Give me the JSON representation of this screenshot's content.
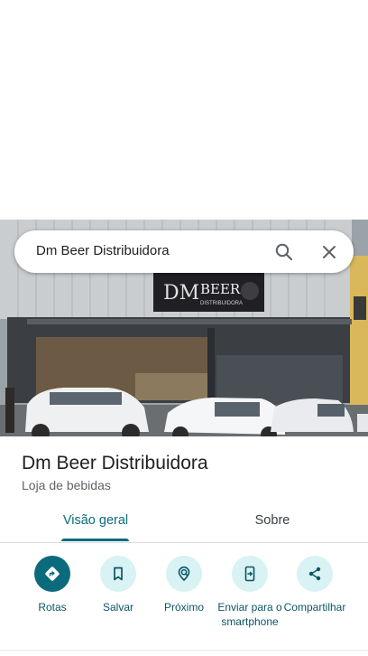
{
  "search": {
    "query": "Dm Beer Distribuidora"
  },
  "photo": {
    "sign_brand": "BEER",
    "sign_sub": "DISTRIBUIDORA"
  },
  "place": {
    "title": "Dm Beer Distribuidora",
    "category": "Loja de bebidas"
  },
  "tabs": [
    {
      "label": "Visão geral",
      "active": true
    },
    {
      "label": "Sobre",
      "active": false
    }
  ],
  "actions": [
    {
      "label": "Rotas",
      "icon": "directions-icon"
    },
    {
      "label": "Salvar",
      "icon": "bookmark-icon"
    },
    {
      "label": "Próximo",
      "icon": "nearby-icon"
    },
    {
      "label": "Enviar para o smartphone",
      "icon": "send-to-phone-icon"
    },
    {
      "label": "Compartilhar",
      "icon": "share-icon"
    }
  ],
  "colors": {
    "accent": "#0b6b7d",
    "chip_bg": "#d9f2f4",
    "label": "#0b5565"
  }
}
